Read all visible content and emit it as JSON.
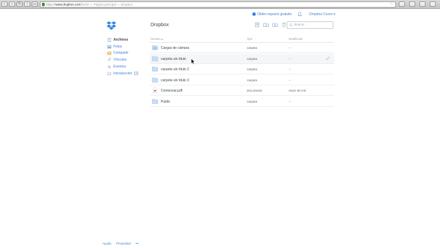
{
  "browser": {
    "url_protocol": "https://",
    "url_host": "www.dropbox.com",
    "url_rest": "/home — Página principal — Dropbox"
  },
  "topbar": {
    "upsell_label": "Obtén espacio gratuito",
    "account_label": "Dropbox Curso ▾"
  },
  "sidebar": {
    "items": [
      {
        "label": "Archivos",
        "icon": "files-icon"
      },
      {
        "label": "Fotos",
        "icon": "photos-icon"
      },
      {
        "label": "Compartir",
        "icon": "share-icon"
      },
      {
        "label": "Vínculos",
        "icon": "links-icon"
      },
      {
        "label": "Eventos",
        "icon": "events-icon"
      },
      {
        "label": "Introducción",
        "icon": "intro-icon",
        "badge": "1"
      }
    ]
  },
  "main": {
    "title": "Dropbox",
    "search_placeholder": "Buscar",
    "columns": {
      "name": "Nombre ▴",
      "type": "Tipo",
      "modified": "Modificado"
    }
  },
  "rows": [
    {
      "name": "Cargas de cámara",
      "type": "carpeta",
      "modified": "--",
      "icon": "camera-folder-icon"
    },
    {
      "name": "carpeta sin título",
      "type": "carpeta",
      "modified": "--",
      "icon": "folder-icon"
    },
    {
      "name": "carpeta sin título 2",
      "type": "carpeta",
      "modified": "--",
      "icon": "folder-icon"
    },
    {
      "name": "carpeta sin título 3",
      "type": "carpeta",
      "modified": "--",
      "icon": "folder-icon"
    },
    {
      "name": "Comenzar.pdf",
      "type": "documento",
      "modified": "Hace 48 min",
      "icon": "pdf-icon"
    },
    {
      "name": "Public",
      "type": "carpeta",
      "modified": "--",
      "icon": "folder-icon"
    }
  ],
  "footer": {
    "help": "Ayuda",
    "privacy": "Privacidad",
    "more": "•••"
  },
  "colors": {
    "link_blue": "#3d7fd3",
    "folder_blue": "#8fb6e6",
    "row_hover": "#f4f6f8"
  }
}
